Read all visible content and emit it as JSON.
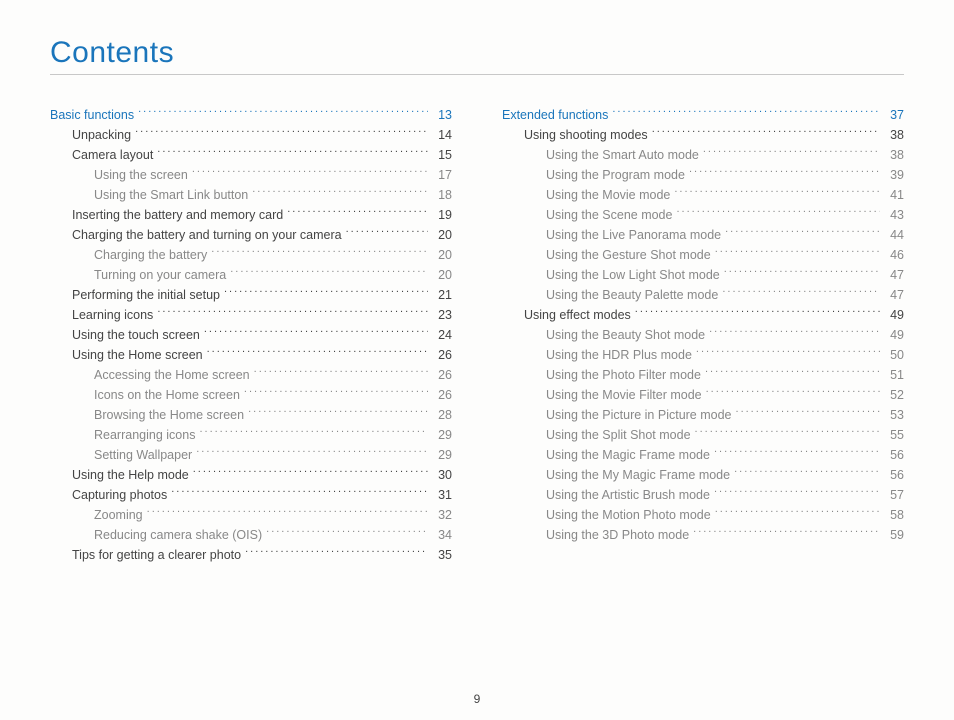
{
  "title": "Contents",
  "page_number": "9",
  "columns": [
    [
      {
        "label": "Basic functions",
        "page": "13",
        "level": 0,
        "section": true
      },
      {
        "label": "Unpacking",
        "page": "14",
        "level": 1
      },
      {
        "label": "Camera layout",
        "page": "15",
        "level": 1
      },
      {
        "label": "Using the screen",
        "page": "17",
        "level": 2
      },
      {
        "label": "Using the Smart Link button",
        "page": "18",
        "level": 2
      },
      {
        "label": "Inserting the battery and memory card",
        "page": "19",
        "level": 1
      },
      {
        "label": "Charging the battery and turning on your camera",
        "page": "20",
        "level": 1
      },
      {
        "label": "Charging the battery",
        "page": "20",
        "level": 2
      },
      {
        "label": "Turning on your camera",
        "page": "20",
        "level": 2
      },
      {
        "label": "Performing the initial setup",
        "page": "21",
        "level": 1
      },
      {
        "label": "Learning icons",
        "page": "23",
        "level": 1
      },
      {
        "label": "Using the touch screen",
        "page": "24",
        "level": 1
      },
      {
        "label": "Using the Home screen",
        "page": "26",
        "level": 1
      },
      {
        "label": "Accessing the Home screen",
        "page": "26",
        "level": 2
      },
      {
        "label": "Icons on the Home screen",
        "page": "26",
        "level": 2
      },
      {
        "label": "Browsing the Home screen",
        "page": "28",
        "level": 2
      },
      {
        "label": "Rearranging icons",
        "page": "29",
        "level": 2
      },
      {
        "label": "Setting Wallpaper",
        "page": "29",
        "level": 2
      },
      {
        "label": "Using the Help mode",
        "page": "30",
        "level": 1
      },
      {
        "label": "Capturing photos",
        "page": "31",
        "level": 1
      },
      {
        "label": "Zooming",
        "page": "32",
        "level": 2
      },
      {
        "label": "Reducing camera shake (OIS)",
        "page": "34",
        "level": 2
      },
      {
        "label": "Tips for getting a clearer photo",
        "page": "35",
        "level": 1
      }
    ],
    [
      {
        "label": "Extended functions",
        "page": "37",
        "level": 0,
        "section": true
      },
      {
        "label": "Using shooting modes",
        "page": "38",
        "level": 1
      },
      {
        "label": "Using the Smart Auto mode",
        "page": "38",
        "level": 2
      },
      {
        "label": "Using the Program mode",
        "page": "39",
        "level": 2
      },
      {
        "label": "Using the Movie mode",
        "page": "41",
        "level": 2
      },
      {
        "label": "Using the Scene mode",
        "page": "43",
        "level": 2
      },
      {
        "label": "Using the Live Panorama mode",
        "page": "44",
        "level": 2
      },
      {
        "label": "Using the Gesture Shot mode",
        "page": "46",
        "level": 2
      },
      {
        "label": "Using the Low Light Shot mode",
        "page": "47",
        "level": 2
      },
      {
        "label": "Using the Beauty Palette mode",
        "page": "47",
        "level": 2
      },
      {
        "label": "Using effect modes",
        "page": "49",
        "level": 1
      },
      {
        "label": "Using the Beauty Shot mode",
        "page": "49",
        "level": 2
      },
      {
        "label": "Using the HDR Plus mode",
        "page": "50",
        "level": 2
      },
      {
        "label": "Using the Photo Filter mode",
        "page": "51",
        "level": 2
      },
      {
        "label": "Using the Movie Filter mode",
        "page": "52",
        "level": 2
      },
      {
        "label": "Using the Picture in Picture mode",
        "page": "53",
        "level": 2
      },
      {
        "label": "Using the Split Shot mode",
        "page": "55",
        "level": 2
      },
      {
        "label": "Using the Magic Frame mode",
        "page": "56",
        "level": 2
      },
      {
        "label": "Using the My Magic Frame mode",
        "page": "56",
        "level": 2
      },
      {
        "label": "Using the Artistic Brush mode",
        "page": "57",
        "level": 2
      },
      {
        "label": "Using the Motion Photo mode",
        "page": "58",
        "level": 2
      },
      {
        "label": "Using the 3D Photo mode",
        "page": "59",
        "level": 2
      }
    ]
  ]
}
